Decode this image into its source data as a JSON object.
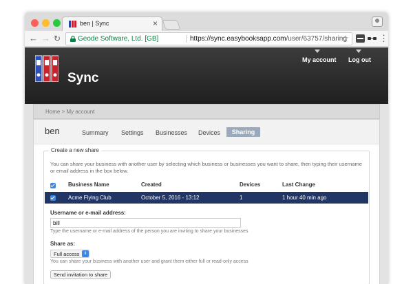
{
  "browser": {
    "tab_title": "ben | Sync",
    "tab_close": "×",
    "org": "Geode Software, Ltd. [GB]",
    "url_host": "https://sync.easybooksapp.com",
    "url_path": "/user/63757/sharing",
    "nav_back": "←",
    "nav_forward": "→",
    "nav_reload": "↻",
    "star": "☆",
    "menu": "⋮"
  },
  "header": {
    "brand": "Sync",
    "nav": [
      "My account",
      "Log out"
    ]
  },
  "breadcrumb": "Home > My account",
  "user": {
    "name": "ben"
  },
  "tabs": [
    {
      "label": "Summary",
      "active": false
    },
    {
      "label": "Settings",
      "active": false
    },
    {
      "label": "Businesses",
      "active": false
    },
    {
      "label": "Devices",
      "active": false
    },
    {
      "label": "Sharing",
      "active": true
    }
  ],
  "share": {
    "legend": "Create a new share",
    "intro": "You can share your business with another user by selecting which business or businesses you want to share, then typing their username or email address in the box below.",
    "columns": [
      "Business Name",
      "Created",
      "Devices",
      "Last Change"
    ],
    "rows": [
      {
        "selected": true,
        "business": "Acme Flying Club",
        "created": "October 5, 2016 - 13:12",
        "devices": "1",
        "last_change": "1 hour 40 min ago"
      }
    ],
    "username_label": "Username or e-mail address:",
    "username_value": "bill",
    "username_help": "Type the username or e-mail address of the person you are inviting to share your businesses",
    "share_as_label": "Share as:",
    "share_as_value": "Full access",
    "share_as_help": "You can share your business with another user and grant them either full or read-only access",
    "send_button": "Send invitation to share"
  },
  "colors": {
    "selected_row": "#213665",
    "active_tab": "#9aaabc",
    "checkbox": "#3b87e6",
    "header_bg": "#2a2a2a"
  }
}
